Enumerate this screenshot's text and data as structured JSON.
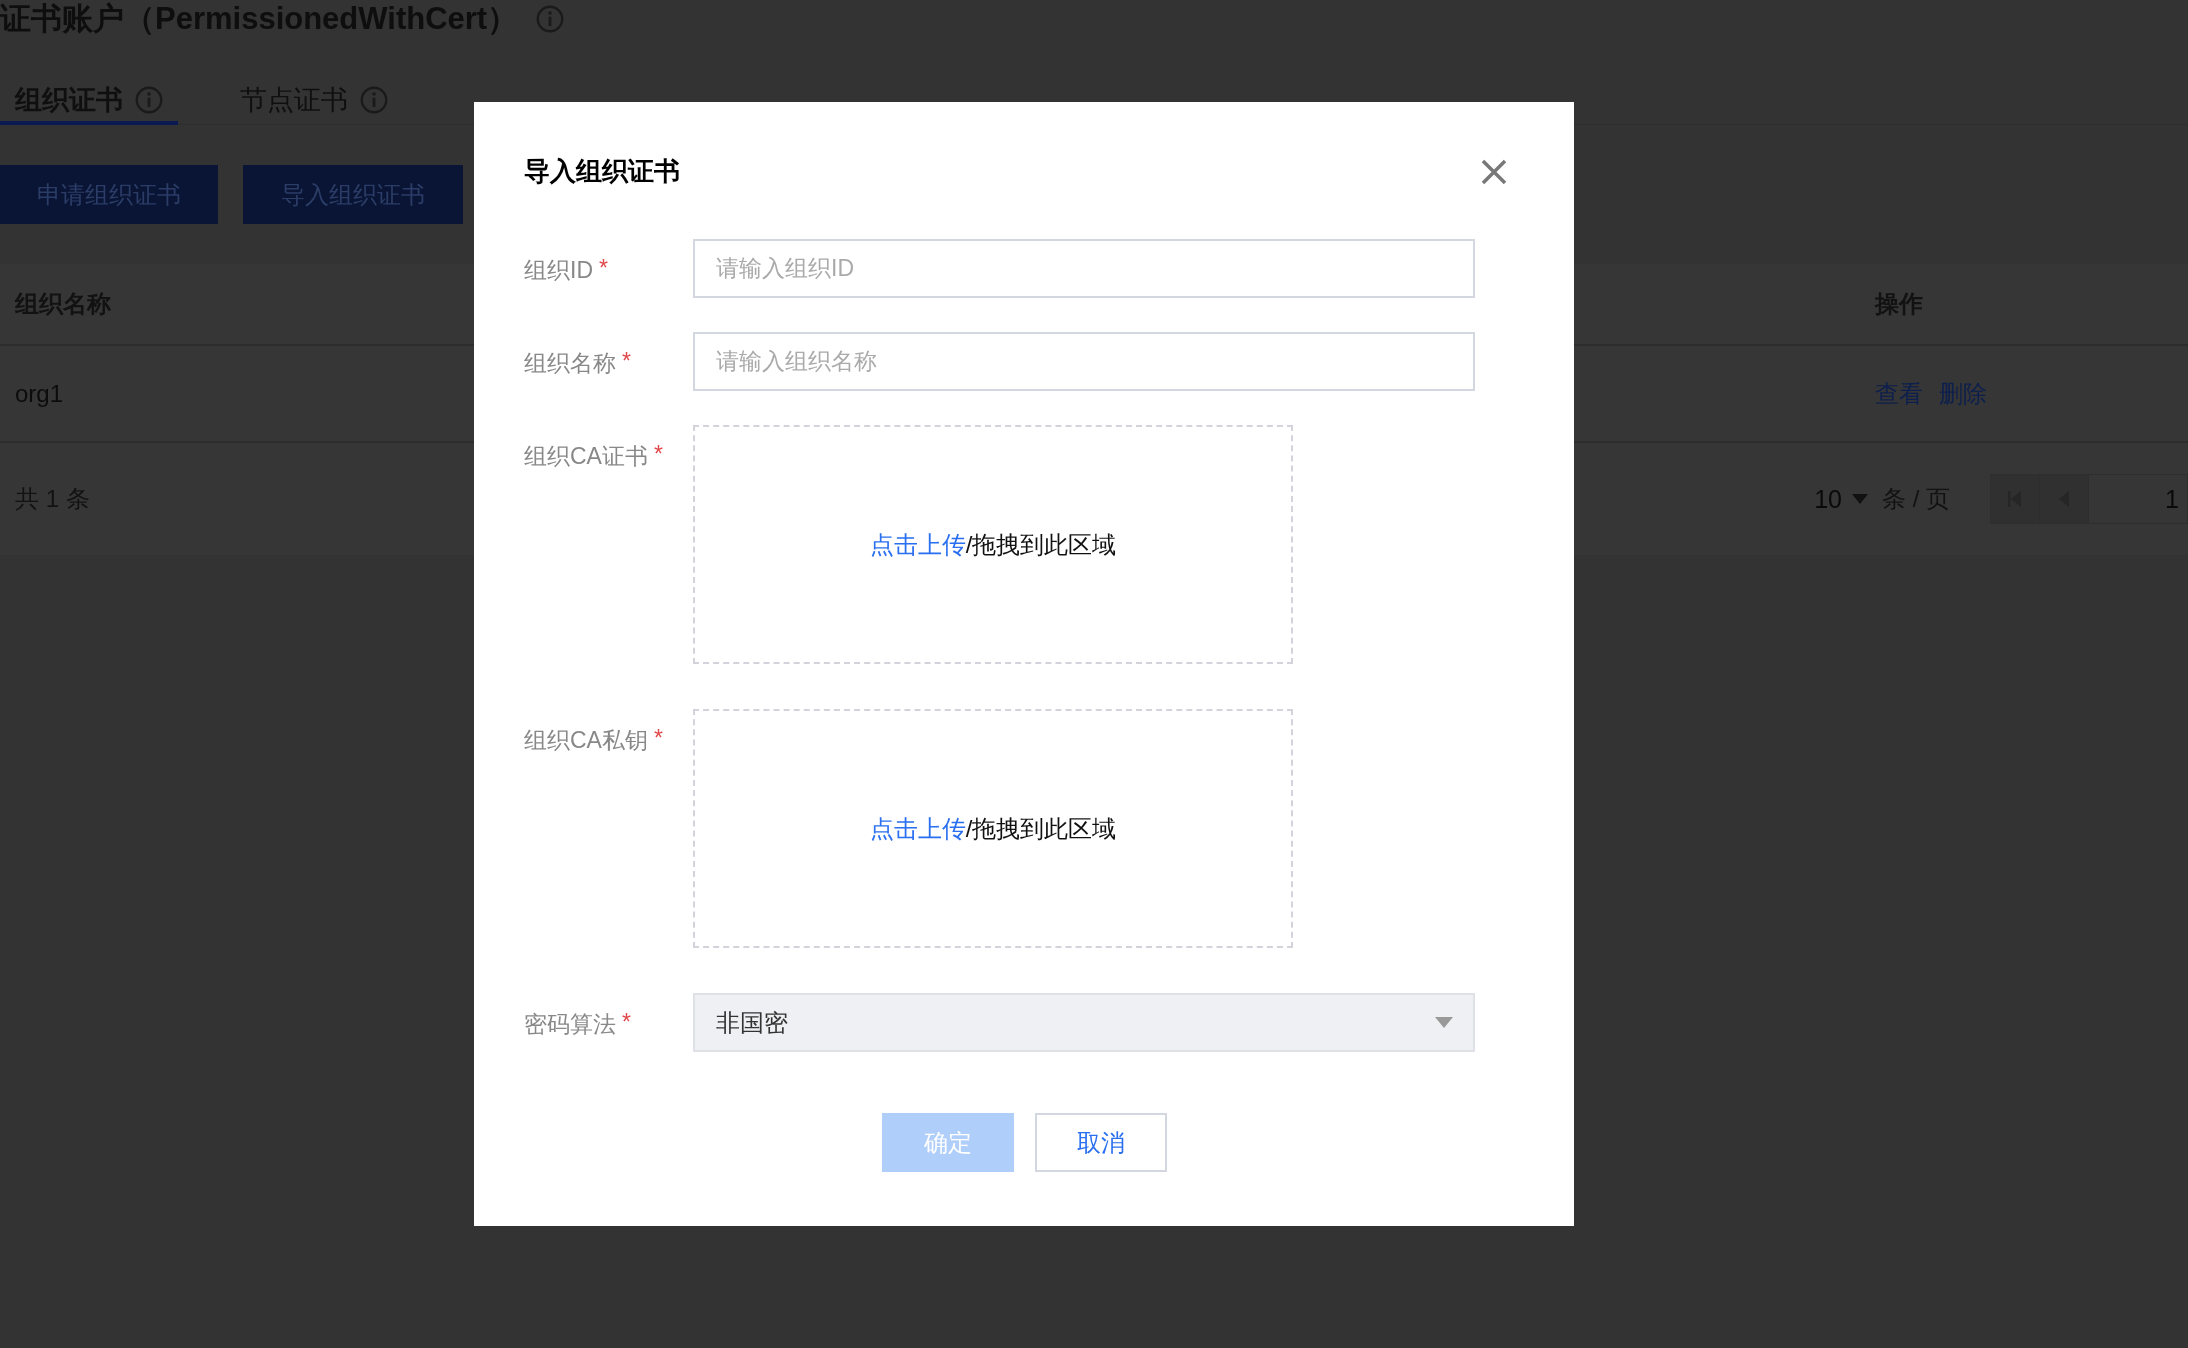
{
  "page": {
    "title": "证书账户（PermissionedWithCert）"
  },
  "tabs": [
    {
      "label": "组织证书",
      "selected": true
    },
    {
      "label": "节点证书",
      "selected": false
    }
  ],
  "toolbar_buttons": [
    "申请组织证书",
    "导入组织证书"
  ],
  "table": {
    "columns": [
      "组织名称",
      "操作"
    ],
    "rows": [
      {
        "name": "org1",
        "actions": [
          "查看",
          "删除"
        ]
      }
    ]
  },
  "pagination": {
    "total": "共 1 条",
    "page_size": "10",
    "per_page_label": "条 / 页",
    "page": "1"
  },
  "dialog": {
    "title": "导入组织证书",
    "fields": [
      {
        "kind": "input",
        "label": "组织ID",
        "required_mark": "*",
        "placeholder": "请输入组织ID"
      },
      {
        "kind": "input",
        "label": "组织名称",
        "required_mark": "*",
        "placeholder": "请输入组织名称"
      },
      {
        "kind": "upload",
        "label": "组织CA证书",
        "required_mark": "*",
        "link": "点击上传",
        "hint": "/拖拽到此区域"
      },
      {
        "kind": "upload",
        "label": "组织CA私钥",
        "required_mark": "*",
        "link": "点击上传",
        "hint": "/拖拽到此区域"
      },
      {
        "kind": "select",
        "label": "密码算法",
        "required_mark": "*",
        "value": "非国密"
      }
    ],
    "buttons": [
      {
        "label": "确定",
        "kind": "primary",
        "disabled": true
      },
      {
        "label": "取消",
        "kind": "secondary",
        "disabled": false
      }
    ]
  }
}
